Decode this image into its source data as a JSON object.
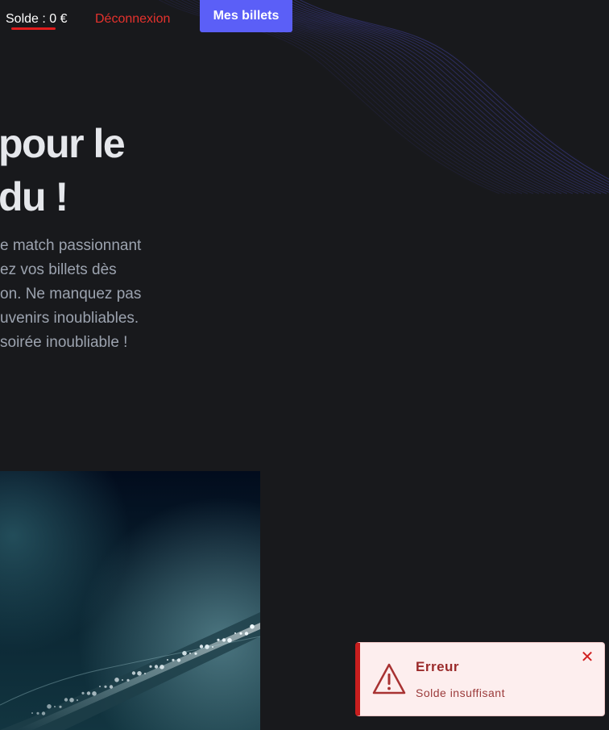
{
  "header": {
    "balance_label": "Solde : 0 €",
    "logout_label": "Déconnexion",
    "tickets_button_label": "Mes billets"
  },
  "hero": {
    "title_lines": [
      "pour le",
      "du !"
    ],
    "description_lines": [
      "e match passionnant",
      "ez vos billets dès",
      "on. Ne manquez pas",
      "uvenirs inoubliables.",
      "soirée inoubliable !"
    ]
  },
  "toast": {
    "title": "Erreur",
    "message": "Solde insuffisant",
    "icon": "warning-triangle-icon",
    "close_icon": "close-icon"
  },
  "colors": {
    "background": "#18191c",
    "accent": "#5b5ff7",
    "danger": "#e5322d",
    "toast_background": "#fdeeee"
  }
}
